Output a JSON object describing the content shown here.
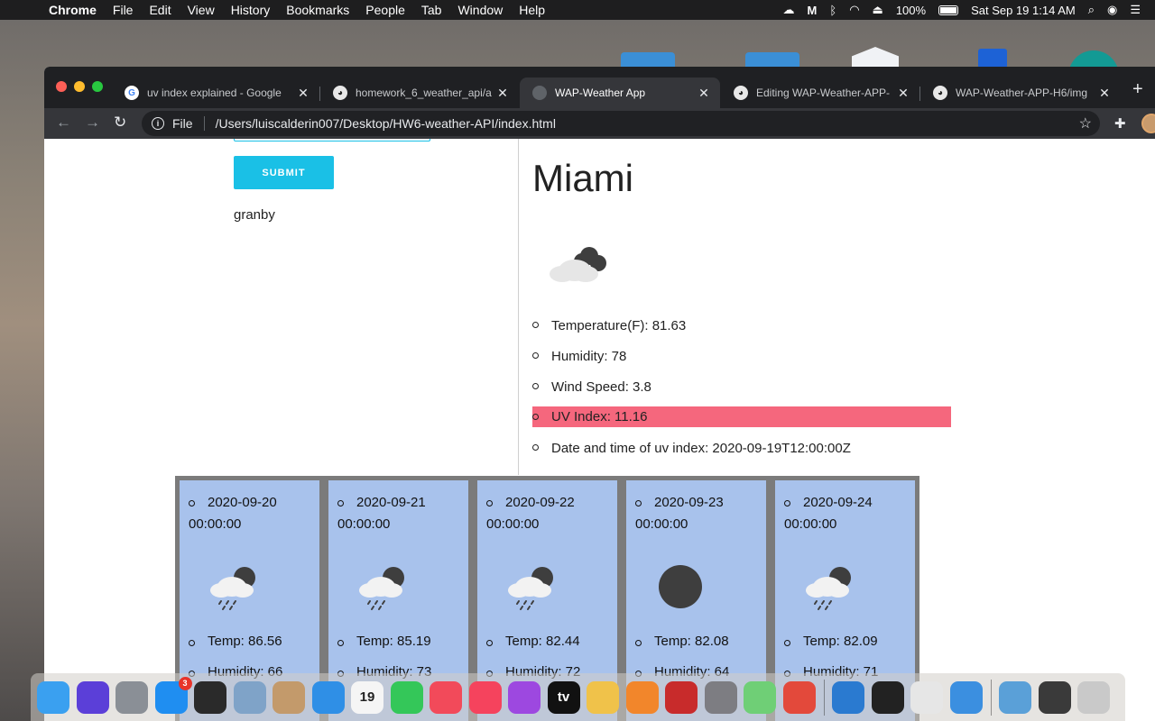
{
  "menubar": {
    "app_name": "Chrome",
    "menus": [
      "File",
      "Edit",
      "View",
      "History",
      "Bookmarks",
      "People",
      "Tab",
      "Window",
      "Help"
    ],
    "battery": "100%",
    "datetime": "Sat Sep 19  1:14 AM"
  },
  "browser": {
    "tabs": [
      {
        "title": "uv index explained - Google",
        "favicon": "google-icon",
        "active": false
      },
      {
        "title": "homework_6_weather_api/a",
        "favicon": "github-icon",
        "active": false
      },
      {
        "title": "WAP-Weather App",
        "favicon": "globe-icon",
        "active": true
      },
      {
        "title": "Editing WAP-Weather-APP-",
        "favicon": "github-icon",
        "active": false
      },
      {
        "title": "WAP-Weather-APP-H6/img",
        "favicon": "github-icon",
        "active": false
      }
    ],
    "address": {
      "scheme_label": "File",
      "url": "/Users/luiscalderin007/Desktop/HW6-weather-API/index.html"
    }
  },
  "search": {
    "submit_label": "SUBMIT",
    "history": [
      "granby"
    ]
  },
  "current": {
    "city": "Miami",
    "icon": "cloudy-night-icon",
    "temperature": "Temperature(F): 81.63",
    "humidity": "Humidity: 78",
    "wind": "Wind Speed: 3.8",
    "uv": "UV Index: 11.16",
    "uv_time": "Date and time of uv index: 2020-09-19T12:00:00Z",
    "uv_highlight_color": "#f5677d"
  },
  "forecast": [
    {
      "date": "2020-09-20",
      "time": "00:00:00",
      "icon": "rain-night-icon",
      "temp": "Temp: 86.56",
      "humidity": "Humidity: 66"
    },
    {
      "date": "2020-09-21",
      "time": "00:00:00",
      "icon": "rain-night-icon",
      "temp": "Temp: 85.19",
      "humidity": "Humidity: 73"
    },
    {
      "date": "2020-09-22",
      "time": "00:00:00",
      "icon": "rain-night-icon",
      "temp": "Temp: 82.44",
      "humidity": "Humidity: 72"
    },
    {
      "date": "2020-09-23",
      "time": "00:00:00",
      "icon": "clear-night-icon",
      "temp": "Temp: 82.08",
      "humidity": "Humidity: 64"
    },
    {
      "date": "2020-09-24",
      "time": "00:00:00",
      "icon": "rain-night-icon",
      "temp": "Temp: 82.09",
      "humidity": "Humidity: 71"
    }
  ],
  "forecast_card_color": "#a8c2ec",
  "accent_color": "#1ac0e6",
  "dock": {
    "apps": [
      {
        "name": "finder-icon",
        "color": "#3aa0f0"
      },
      {
        "name": "siri-icon",
        "color": "#5b3fd8"
      },
      {
        "name": "launchpad-icon",
        "color": "#8a8f96"
      },
      {
        "name": "app-store-icon",
        "color": "#1f8ef1",
        "badge": "3"
      },
      {
        "name": "activity-monitor-icon",
        "color": "#2a2a2a"
      },
      {
        "name": "preview-icon",
        "color": "#7fa3c8"
      },
      {
        "name": "contacts-icon",
        "color": "#c39a6b"
      },
      {
        "name": "safari-icon",
        "color": "#2f8fe6"
      },
      {
        "name": "calendar-icon",
        "color": "#f5f5f5",
        "label": "19"
      },
      {
        "name": "facetime-icon",
        "color": "#34c759"
      },
      {
        "name": "news-icon",
        "color": "#f24a5a"
      },
      {
        "name": "music-icon",
        "color": "#f5435d"
      },
      {
        "name": "podcasts-icon",
        "color": "#9d48e0"
      },
      {
        "name": "apple-tv-icon",
        "color": "#111111",
        "label": "tv"
      },
      {
        "name": "photos-icon",
        "color": "#f0c24a"
      },
      {
        "name": "books-icon",
        "color": "#f2862b"
      },
      {
        "name": "photo-booth-icon",
        "color": "#c82b2b"
      },
      {
        "name": "system-preferences-icon",
        "color": "#7d7d82"
      },
      {
        "name": "maps-icon",
        "color": "#6fcf76"
      },
      {
        "name": "chrome-icon",
        "color": "#e3493b"
      }
    ],
    "apps_right": [
      {
        "name": "vscode-icon",
        "color": "#2a7ad0"
      },
      {
        "name": "terminal-icon",
        "color": "#222222"
      },
      {
        "name": "slack-icon",
        "color": "#e6e6e6"
      },
      {
        "name": "xcode-icon",
        "color": "#3b8fe0"
      }
    ],
    "stacks": [
      {
        "name": "downloads-folder-icon",
        "color": "#5aa0d8"
      },
      {
        "name": "screenshot-stack-icon",
        "color": "#3a3a3a"
      },
      {
        "name": "trash-icon",
        "color": "#c9c9c9"
      }
    ]
  }
}
